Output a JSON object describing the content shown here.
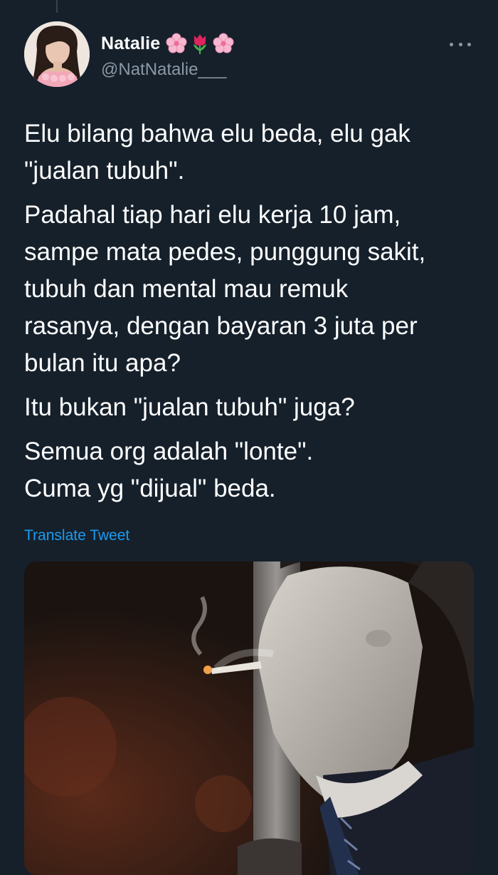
{
  "tweet": {
    "author": {
      "display_name": "Natalie",
      "name_emojis": [
        "cherry-blossom",
        "tulip",
        "cherry-blossom"
      ],
      "handle": "@NatNatalie___"
    },
    "paragraphs": [
      [
        "Elu bilang bahwa elu beda, elu gak",
        "\"jualan tubuh\"."
      ],
      [
        "Padahal tiap hari elu kerja 10 jam,",
        "sampe mata pedes, punggung sakit,",
        "tubuh dan mental mau remuk",
        "rasanya, dengan bayaran 3 juta per",
        "bulan itu apa?"
      ],
      [
        "Itu bukan \"jualan tubuh\" juga?"
      ],
      [
        "Semua org adalah \"lonte\".",
        "Cuma yg \"dijual\" beda."
      ]
    ],
    "translate_label": "Translate Tweet",
    "more_icon": "more-horizontal-icon"
  },
  "theme": {
    "background": "#15202b",
    "text": "#ffffff",
    "secondary_text": "#8b98a5",
    "link": "#1d9bf0"
  }
}
